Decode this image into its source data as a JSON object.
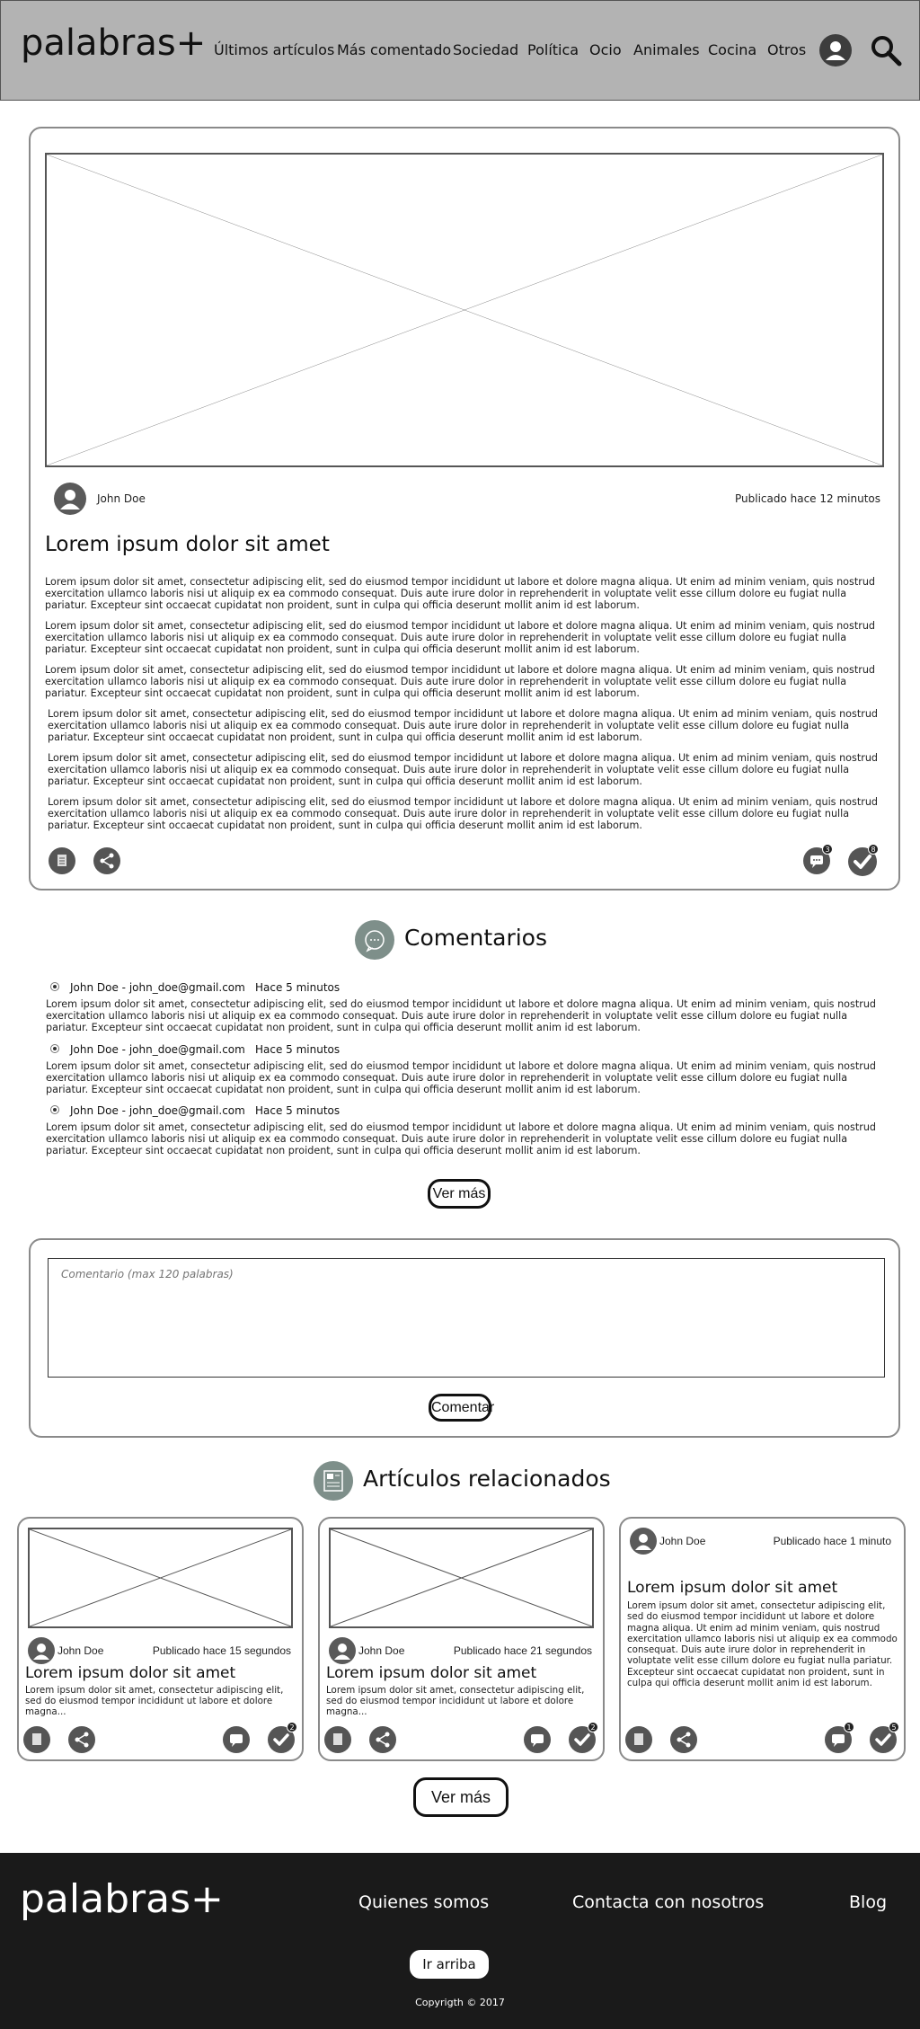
{
  "header": {
    "logo": "palabras+",
    "nav": [
      "Últimos artículos",
      "Más comentado",
      "Sociedad",
      "Política",
      "Ocio",
      "Animales",
      "Cocina",
      "Otros"
    ]
  },
  "article": {
    "author": "John Doe",
    "published": "Publicado hace 12 minutos",
    "title": "Lorem ipsum dolor sit amet",
    "paragraph": "Lorem ipsum dolor sit amet, consectetur adipiscing elit, sed do eiusmod tempor incididunt ut labore et dolore magna aliqua. Ut enim ad minim veniam, quis nostrud exercitation ullamco laboris nisi ut aliquip ex ea commodo consequat. Duis aute irure dolor in reprehenderit in voluptate velit esse cillum dolore eu fugiat nulla pariatur. Excepteur sint occaecat cupidatat non proident, sunt in culpa qui officia deserunt mollit anim id est laborum.",
    "comments_count": "3",
    "checks_count": "8"
  },
  "comments": {
    "heading": "Comentarios",
    "items": [
      {
        "author": "John Doe - john_doe@gmail.com",
        "time": "Hace 5 minutos",
        "text": "Lorem ipsum dolor sit amet, consectetur adipiscing elit, sed do eiusmod tempor incididunt ut labore et dolore magna aliqua. Ut enim ad minim veniam, quis nostrud exercitation ullamco laboris nisi ut aliquip ex ea commodo consequat. Duis aute irure dolor in reprehenderit in voluptate velit esse cillum dolore eu fugiat nulla pariatur. Excepteur sint occaecat cupidatat non proident, sunt in culpa qui officia deserunt mollit anim id est laborum."
      },
      {
        "author": "John Doe - john_doe@gmail.com",
        "time": "Hace 5 minutos",
        "text": "Lorem ipsum dolor sit amet, consectetur adipiscing elit, sed do eiusmod tempor incididunt ut labore et dolore magna aliqua. Ut enim ad minim veniam, quis nostrud exercitation ullamco laboris nisi ut aliquip ex ea commodo consequat. Duis aute irure dolor in reprehenderit in voluptate velit esse cillum dolore eu fugiat nulla pariatur. Excepteur sint occaecat cupidatat non proident, sunt in culpa qui officia deserunt mollit anim id est laborum."
      },
      {
        "author": "John Doe - john_doe@gmail.com",
        "time": "Hace 5 minutos",
        "text": "Lorem ipsum dolor sit amet, consectetur adipiscing elit, sed do eiusmod tempor incididunt ut labore et dolore magna aliqua. Ut enim ad minim veniam, quis nostrud exercitation ullamco laboris nisi ut aliquip ex ea commodo consequat. Duis aute irure dolor in reprehenderit in voluptate velit esse cillum dolore eu fugiat nulla pariatur. Excepteur sint occaecat cupidatat non proident, sunt in culpa qui officia deserunt mollit anim id est laborum."
      }
    ],
    "more_label": "Ver más"
  },
  "comment_form": {
    "placeholder": "Comentario (max 120 palabras)",
    "submit_label": "Comentar"
  },
  "related": {
    "heading": "Artículos relacionados",
    "cards": [
      {
        "author": "John Doe",
        "published": "Publicado hace 15 segundos",
        "title": "Lorem ipsum dolor sit amet",
        "excerpt": "Lorem ipsum dolor sit amet, consectetur adipiscing elit, sed do eiusmod tempor incididunt ut labore et dolore magna...",
        "checks_count": "2"
      },
      {
        "author": "John Doe",
        "published": "Publicado hace 21 segundos",
        "title": "Lorem ipsum dolor sit amet",
        "excerpt": "Lorem ipsum dolor sit amet, consectetur adipiscing elit, sed do eiusmod tempor incididunt ut labore et dolore magna...",
        "checks_count": "2"
      },
      {
        "author": "John Doe",
        "published": "Publicado hace 1 minuto",
        "title": "Lorem ipsum dolor sit amet",
        "excerpt": "Lorem ipsum dolor sit amet, consectetur adipiscing elit, sed do eiusmod tempor incididunt ut labore et dolore magna aliqua. Ut enim ad minim veniam, quis nostrud exercitation ullamco laboris nisi ut aliquip ex ea commodo consequat. Duis aute irure dolor in reprehenderit in voluptate velit esse cillum dolore eu fugiat nulla pariatur. Excepteur sint occaecat cupidatat non proident, sunt in culpa qui officia deserunt mollit anim id est laborum.",
        "comments_count": "1",
        "checks_count": "5"
      }
    ],
    "more_label": "Ver más"
  },
  "footer": {
    "logo": "palabras+",
    "links": [
      "Quienes somos",
      "Contacta con nosotros",
      "Blog"
    ],
    "top_label": "Ir arriba",
    "copyright": "Copyrigth © 2017"
  },
  "colors": {
    "header_bg": "#b3b3b3",
    "footer_bg": "#1a1a1a",
    "icon_gray": "#555555"
  }
}
